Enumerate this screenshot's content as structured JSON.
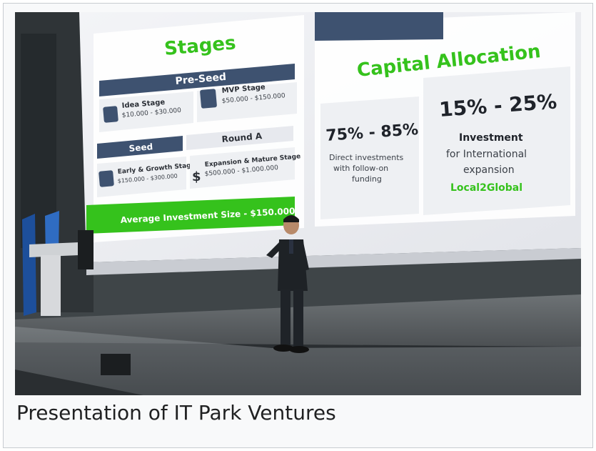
{
  "caption": "Presentation of IT Park Ventures",
  "slide": {
    "stages_title": "Stages",
    "preseed_label": "Pre-Seed",
    "idea_stage": "Idea Stage",
    "idea_range": "$10.000 - $30.000",
    "mvp_stage": "MVP Stage",
    "mvp_range": "$50.000 - $150.000",
    "seed_label": "Seed",
    "round_a_label": "Round A",
    "early_growth": "Early & Growth Stage",
    "early_growth_range": "$150.000 - $300.000",
    "expansion": "Expansion & Mature Stage",
    "expansion_range": "$500.000 - $1.000.000",
    "average_size": "Average Investment Size - $150.000",
    "capital_title": "Capital Allocation",
    "pct_left": "75% - 85%",
    "left_line1": "Direct investments",
    "left_line2": "with follow-on",
    "left_line3": "funding",
    "pct_right": "15% - 25%",
    "right_bold": "Investment",
    "right_line1": "for International",
    "right_line2": "expansion",
    "right_green": "Local2Global"
  },
  "colors": {
    "accent_green": "#35c21c",
    "header_navy": "#3e5270",
    "stage_bg": "#3f4347"
  }
}
